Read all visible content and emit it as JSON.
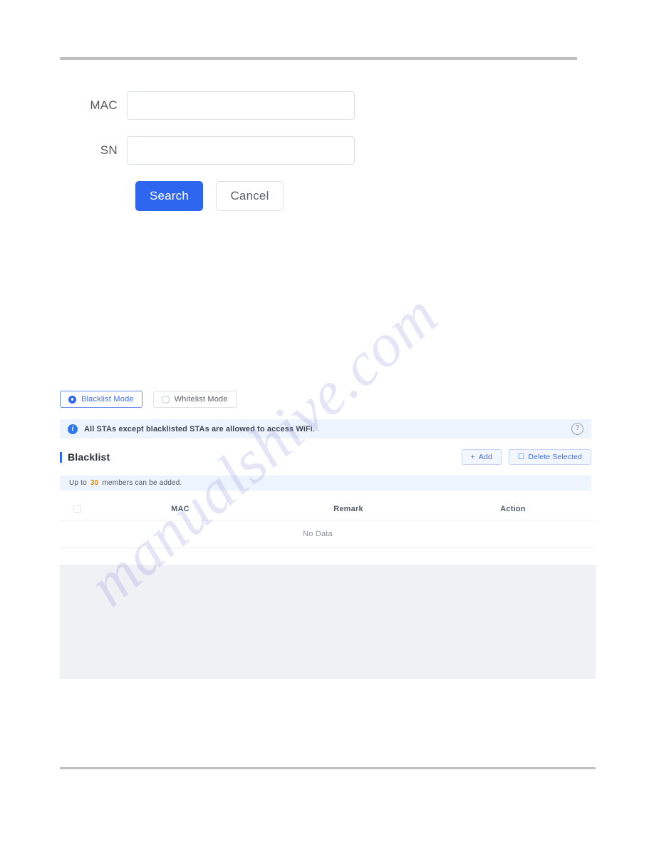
{
  "watermark": {
    "text": "manualshive.com"
  },
  "search_form": {
    "fields": [
      {
        "label": "MAC",
        "value": "",
        "placeholder": ""
      },
      {
        "label": "SN",
        "value": "",
        "placeholder": ""
      }
    ],
    "search_label": "Search",
    "cancel_label": "Cancel",
    "primary_color": "#2f66f0"
  },
  "mode_bar": {
    "options": [
      {
        "label": "Blacklist Mode",
        "selected": true
      },
      {
        "label": "Whitelist Mode",
        "selected": false
      }
    ]
  },
  "info_banner": {
    "icon": "info-icon",
    "text": "All STAs except blacklisted STAs are allowed to access WiFi.",
    "help_icon": "?",
    "background": "#eef4fd"
  },
  "list_header": {
    "title": "Blacklist",
    "add_label": "Add",
    "add_icon": "+",
    "delete_label": "Delete Selected",
    "delete_icon": "☐",
    "accent_color": "#2f66f0"
  },
  "quota": {
    "prefix": "Up to",
    "limit": "30",
    "suffix": "members can be added.",
    "limit_color": "#e68a0c"
  },
  "table": {
    "columns": [
      "MAC",
      "Remark",
      "Action"
    ],
    "rows": [],
    "empty_text": "No Data"
  }
}
